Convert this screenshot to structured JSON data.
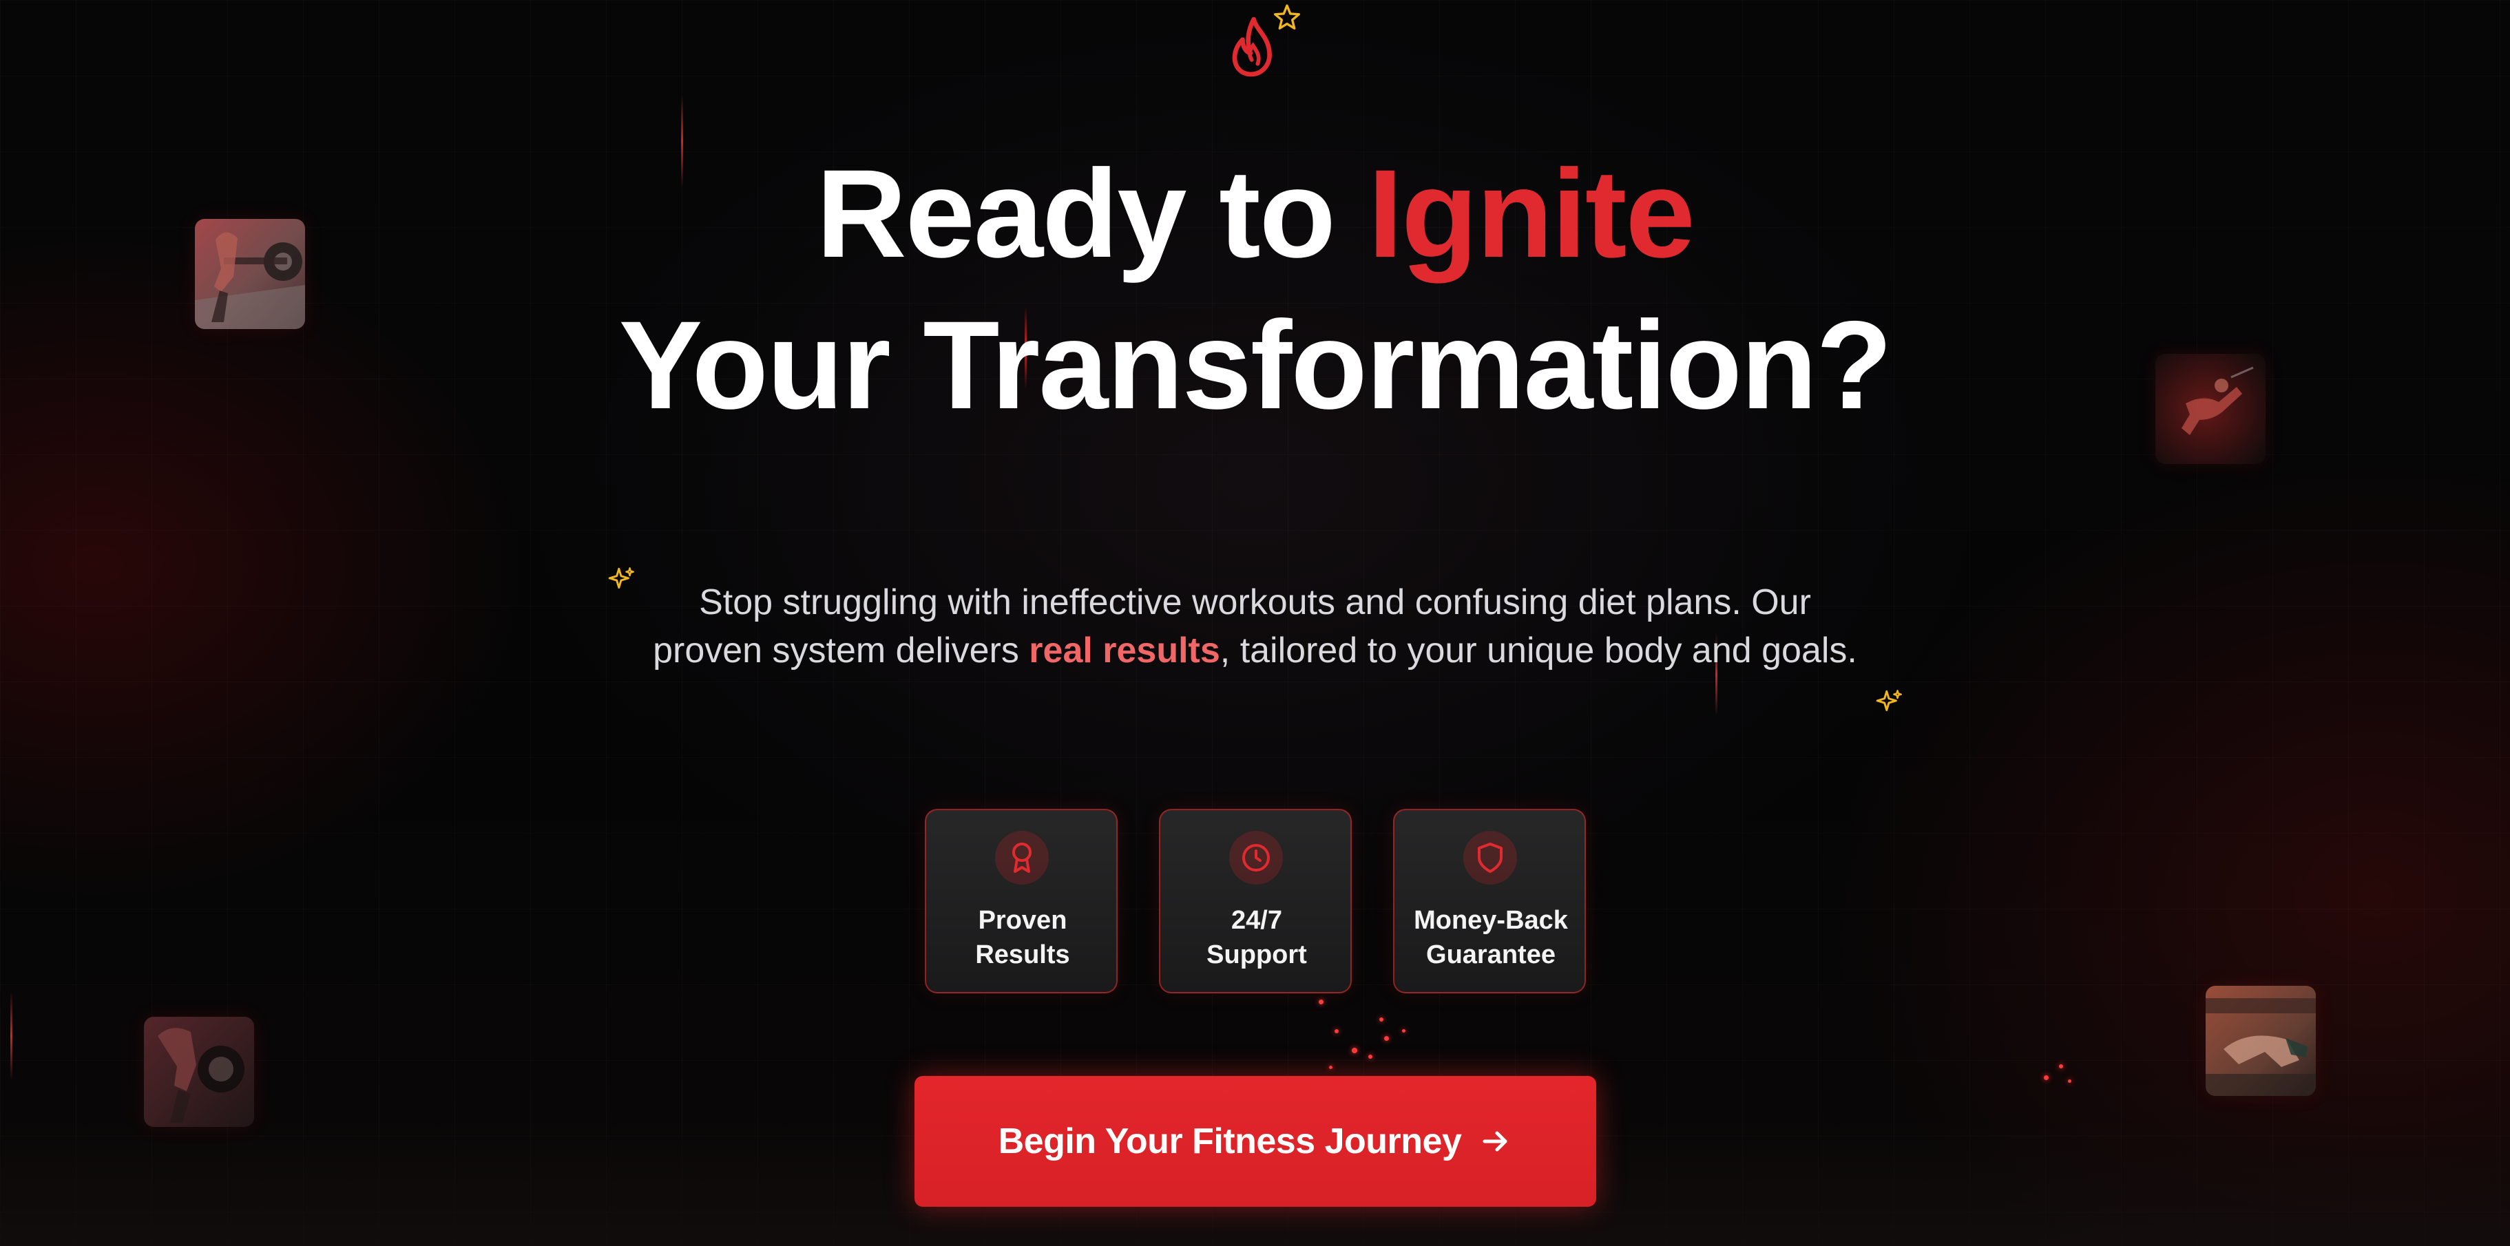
{
  "hero": {
    "headline_line1_prefix": "Ready to ",
    "headline_line1_accent": "Ignite",
    "headline_line2": "Your Transformation?",
    "subtext_before": "Stop struggling with ineffective workouts and confusing diet plans. Our proven system delivers ",
    "subtext_highlight": "real results",
    "subtext_after": ", tailored to your unique body and goals."
  },
  "features": [
    {
      "label_line1": "Proven",
      "label_line2": "Results",
      "icon": "award-icon"
    },
    {
      "label_line1": "24/7",
      "label_line2": "Support",
      "icon": "clock-icon"
    },
    {
      "label_line1": "Money-Back",
      "label_line2": "Guarantee",
      "icon": "shield-icon"
    }
  ],
  "cta": {
    "label": "Begin Your Fitness Journey",
    "icon": "arrow-right-icon"
  },
  "decorations": {
    "top_icons": [
      "flame-icon",
      "star-icon"
    ],
    "sparkles": [
      "sparkle-icon",
      "sparkle-icon"
    ],
    "photos": [
      "deadlift-photo",
      "sprint-photo",
      "lifter-photo",
      "workout-photo"
    ]
  },
  "colors": {
    "accent_red": "#e12a2f",
    "highlight_red": "#f16767",
    "background": "#050506",
    "card_background": "#1f1f20",
    "sparkle_gold": "#f2b61f"
  }
}
